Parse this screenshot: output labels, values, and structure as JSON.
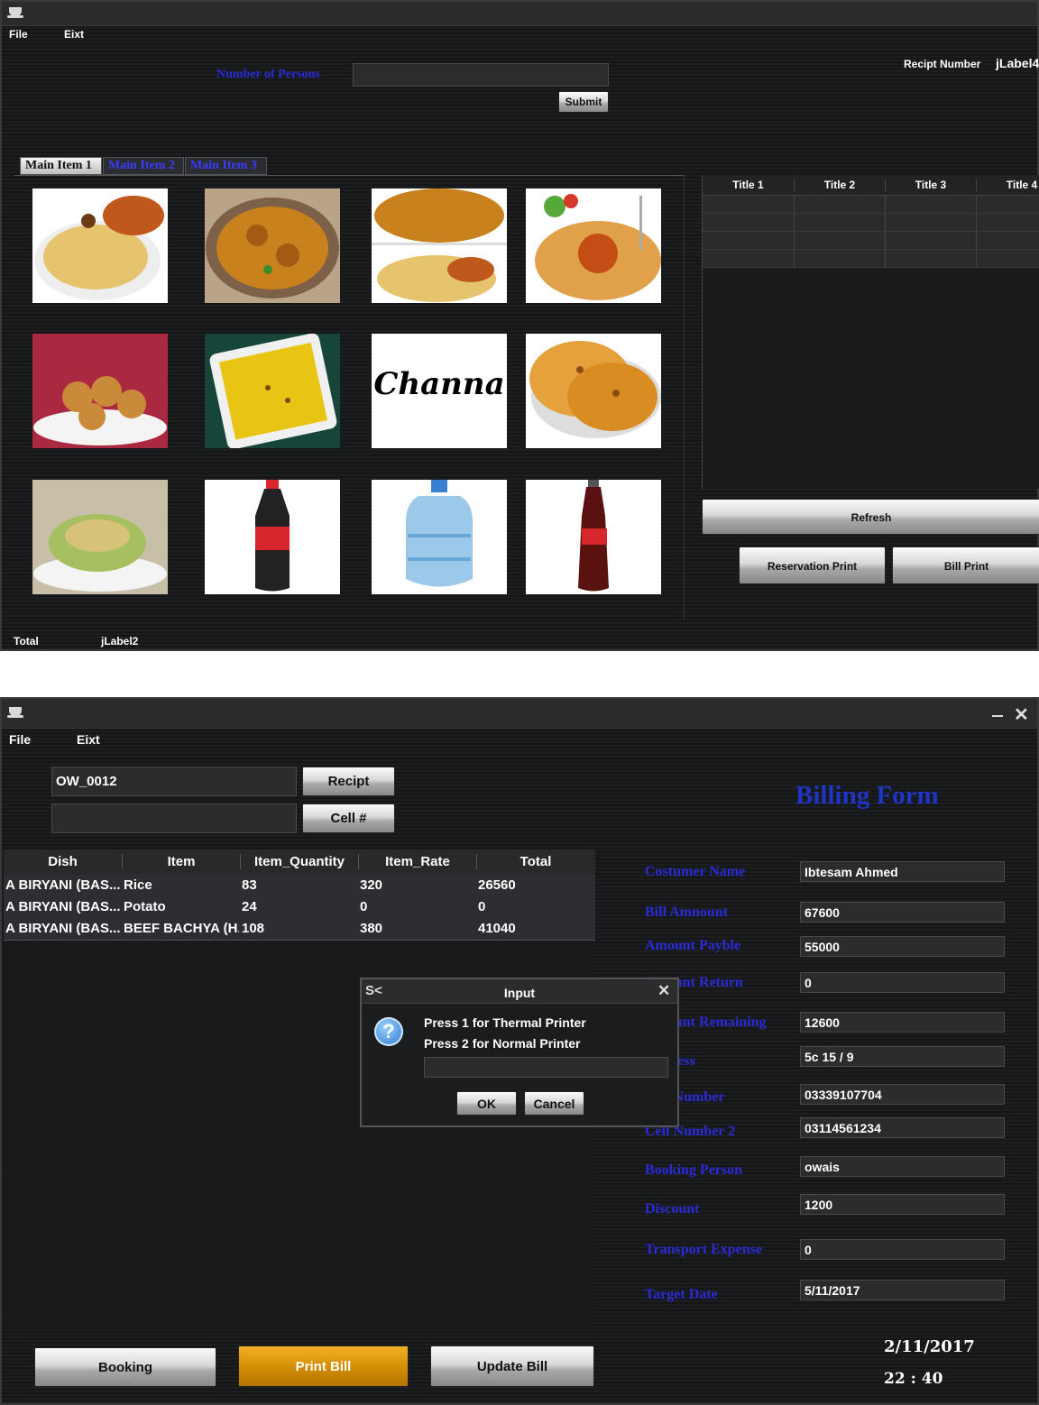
{
  "window1": {
    "menu": {
      "file": "File",
      "exit": "Eixt"
    },
    "persons_label": "Number of Persons",
    "persons_value": "",
    "submit": "Submit",
    "receipt_label": "Recipt Number",
    "receipt_value": "jLabel4",
    "tabs": [
      "Main Item 1",
      "Main Item 2",
      "Main Item 3"
    ],
    "tiles": [
      {
        "name": "biryani-chicken",
        "label": ""
      },
      {
        "name": "chicken-karahi",
        "label": ""
      },
      {
        "name": "karahi-biryani-combo",
        "label": ""
      },
      {
        "name": "chicken-pulao",
        "label": ""
      },
      {
        "name": "egg-dish",
        "label": ""
      },
      {
        "name": "zarda-rice",
        "label": ""
      },
      {
        "name": "channa",
        "label": "Channa"
      },
      {
        "name": "naan",
        "label": ""
      },
      {
        "name": "salad",
        "label": ""
      },
      {
        "name": "coca-cola-bottle",
        "label": ""
      },
      {
        "name": "water-bottle",
        "label": ""
      },
      {
        "name": "coca-cola-glass-bottle",
        "label": ""
      }
    ],
    "table_headers": [
      "Title 1",
      "Title 2",
      "Title 3",
      "Title 4"
    ],
    "refresh": "Refresh",
    "reservation_print": "Reservation Print",
    "bill_print": "Bill Print",
    "total_label": "Total",
    "total_value": "jLabel2"
  },
  "window2": {
    "menu": {
      "file": "File",
      "exit": "Eixt"
    },
    "receipt_field": "OW_0012",
    "cell_field": "",
    "receipt_button": "Recipt",
    "cell_button": "Cell #",
    "title": "Billing Form",
    "table": {
      "headers": [
        "Dish",
        "Item",
        "Item_Quantity",
        "Item_Rate",
        "Total"
      ],
      "rows": [
        [
          "A BIRYANI (BAS...",
          "Rice",
          "83",
          "320",
          "26560"
        ],
        [
          "A BIRYANI (BAS...",
          "Potato",
          "24",
          "0",
          "0"
        ],
        [
          "A BIRYANI (BAS...",
          "BEEF BACHYA (H...",
          "108",
          "380",
          "41040"
        ]
      ]
    },
    "form": [
      {
        "label": "Costumer Name",
        "value": "Ibtesam Ahmed"
      },
      {
        "label": "Bill Amnount",
        "value": "67600"
      },
      {
        "label": "Amount Payble",
        "value": "55000"
      },
      {
        "label": "Amount Return",
        "value": "0"
      },
      {
        "label": "Amount Remaining",
        "value": "12600"
      },
      {
        "label": "Address",
        "value": "5c 15 / 9"
      },
      {
        "label": "Cell Number",
        "value": "03339107704"
      },
      {
        "label": "Cell Number 2",
        "value": "03114561234"
      },
      {
        "label": "Booking Person",
        "value": "owais"
      },
      {
        "label": "Discount",
        "value": "1200"
      },
      {
        "label": "Transport Expense",
        "value": "0"
      },
      {
        "label": "Target Date",
        "value": "5/11/2017"
      }
    ],
    "booking": "Booking",
    "print_bill": "Print Bill",
    "update_bill": "Update Bill",
    "date": "2/11/2017",
    "time": "22 : 40",
    "dialog": {
      "title": "Input",
      "line1": "Press 1 for Thermal Printer",
      "line2": "Press 2 for Normal Printer",
      "input_value": "",
      "ok": "OK",
      "cancel": "Cancel"
    }
  }
}
